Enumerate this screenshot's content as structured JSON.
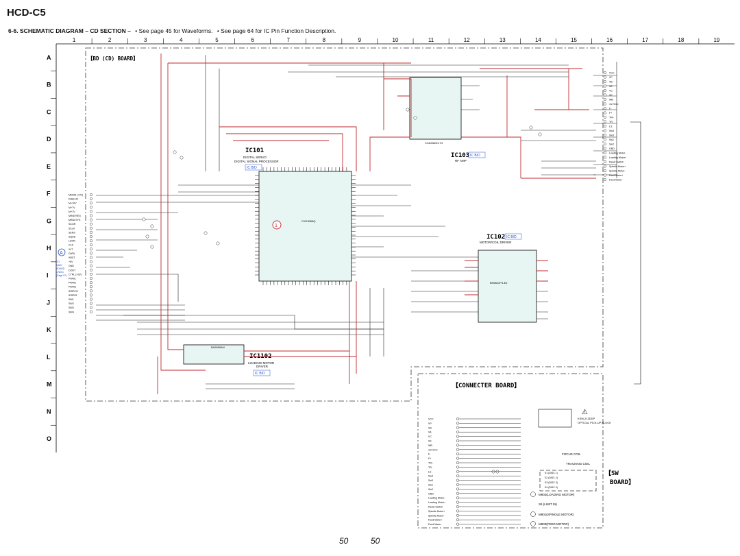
{
  "header": {
    "model": "HCD-C5",
    "section_title": "6-6. SCHEMATIC DIAGRAM – CD SECTION –",
    "notes": [
      "• See page 45 for Waveforms.",
      "• See page 64 for IC Pin Function Description."
    ]
  },
  "grid": {
    "columns": [
      "1",
      "2",
      "3",
      "4",
      "5",
      "6",
      "7",
      "8",
      "9",
      "10",
      "11",
      "12",
      "13",
      "14",
      "15",
      "16",
      "17",
      "18",
      "19"
    ],
    "rows": [
      "A",
      "B",
      "C",
      "D",
      "E",
      "F",
      "G",
      "H",
      "I",
      "J",
      "K",
      "L",
      "M",
      "N",
      "O"
    ]
  },
  "boards": {
    "bd": "【BD (CD)  BOARD】",
    "connecter": "【CONNECTER BOARD】",
    "sw_line1": "【SW",
    "sw_line2": "BOARD】"
  },
  "ics": {
    "ic101": {
      "name": "IC101",
      "desc1": "DIGITAL SERVO",
      "desc2": "DIGITAL SIGNAL PROCESSOR",
      "part": "CXD3068Q",
      "ref": "IC B/D"
    },
    "ic103": {
      "name": "IC103",
      "desc": "RF AMP",
      "part": "CXA2581N-T4",
      "ref": "IC B/D"
    },
    "ic102": {
      "name": "IC102",
      "desc": "MOTOR/COIL DRIVER",
      "part": "BH6511FS-E2",
      "ref": "IC B/D"
    },
    "ic1102": {
      "name": "IC1102",
      "desc1": "LOADING MOTOR",
      "desc2": "DRIVER",
      "part": "BA6956AN",
      "ref": "IC B/D"
    }
  },
  "connector_a": {
    "label": "A",
    "text": [
      "TO",
      "MAIN",
      "BOARD",
      "CN001",
      "(Page 57)"
    ]
  },
  "marker": "1",
  "left_signals": [
    "MDMD (+3V)",
    "DGB+3V",
    "M+10V",
    "M+7V",
    "M+7V",
    "MIND REG",
    "MIND SYS",
    "SCOR",
    "SCLK",
    "SENS",
    "SQDD",
    "LDON",
    "CLK",
    "XLT",
    "DATA",
    "XRST",
    "+5V",
    "GND",
    "DOUT",
    "CTRL (+3V)",
    "PWM1",
    "PWM2",
    "PWM3",
    "IDSPCO",
    "IDSP03",
    "SW1",
    "SW2",
    "SW3",
    "SW4"
  ],
  "right_signals": [
    "VCC",
    "VP",
    "VB",
    "VA",
    "VC",
    "VE",
    "WB",
    "1/2 VCC",
    "F-",
    "F+",
    "TR+",
    "TR-",
    "LS",
    "Sw4",
    "Sw3",
    "Sw1",
    "Sw2",
    "GND",
    "Loading Motor-",
    "Loading Motor+",
    "Reset Switch",
    "Spindle Motor+",
    "Spindle Motor-",
    "Feed Motor+",
    "Feed Motor-"
  ],
  "connecter_labels": [
    "VCC",
    "VP",
    "VB",
    "VA",
    "VC",
    "VE",
    "WB",
    "1/2 VCC",
    "F-",
    "F+",
    "TR+",
    "TR-",
    "LS",
    "Sw4",
    "Sw3",
    "Sw1",
    "Sw2",
    "GND",
    "Loading Motor-",
    "Loading Motor+",
    "Reset Switch",
    "Spindle Motor+",
    "Spindle Motor-",
    "Feed Motor+",
    "Feed Motor-"
  ],
  "parts": {
    "optical": "OPTICAL PICK-UP BLOCK",
    "optical_part": "KSM-213DDP",
    "focus": "FOCUS COIL",
    "tracking": "TRACKING COIL",
    "m902": "M902(LOADING MOTOR)",
    "s5": "S5 (LIMIT IN)",
    "m901": "M901(SPINDLE MOTOR)",
    "m903": "M903(FEED MOTOR)",
    "sw_switches": [
      "S1 (DISC 1)",
      "S2 (DISC 2)",
      "S3 (DISC 3)",
      "S4 (DISC 4)"
    ]
  },
  "page_numbers": {
    "left": "50",
    "right": "50"
  }
}
